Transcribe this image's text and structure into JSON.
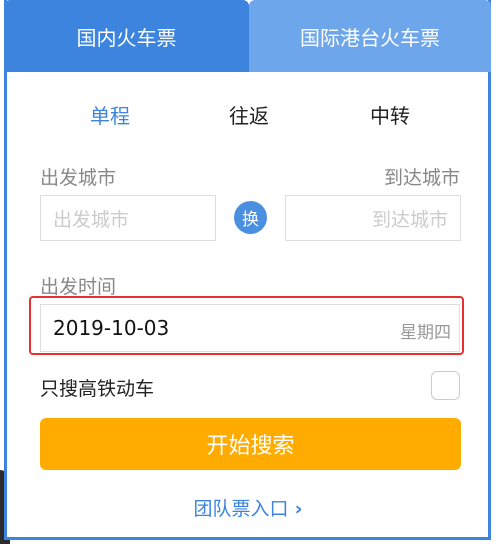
{
  "tabs": [
    {
      "label": "国内火车票",
      "active": true
    },
    {
      "label": "国际港台火车票",
      "active": false
    }
  ],
  "trip_types": [
    {
      "label": "单程",
      "active": true
    },
    {
      "label": "往返",
      "active": false
    },
    {
      "label": "中转",
      "active": false
    }
  ],
  "departure": {
    "label": "出发城市",
    "placeholder": "出发城市"
  },
  "arrival": {
    "label": "到达城市",
    "placeholder": "到达城市"
  },
  "swap_label": "换",
  "date": {
    "label": "出发时间",
    "value": "2019-10-03",
    "weekday": "星期四"
  },
  "high_speed_only": {
    "label": "只搜高铁动车",
    "checked": false
  },
  "search_button": "开始搜索",
  "group_ticket": {
    "label": "团队票入口",
    "chevron": "›"
  },
  "colors": {
    "primary": "#3c84de",
    "tab_inactive": "#6ea6ec",
    "search_button": "#ffab00",
    "highlight": "#e4322f"
  }
}
